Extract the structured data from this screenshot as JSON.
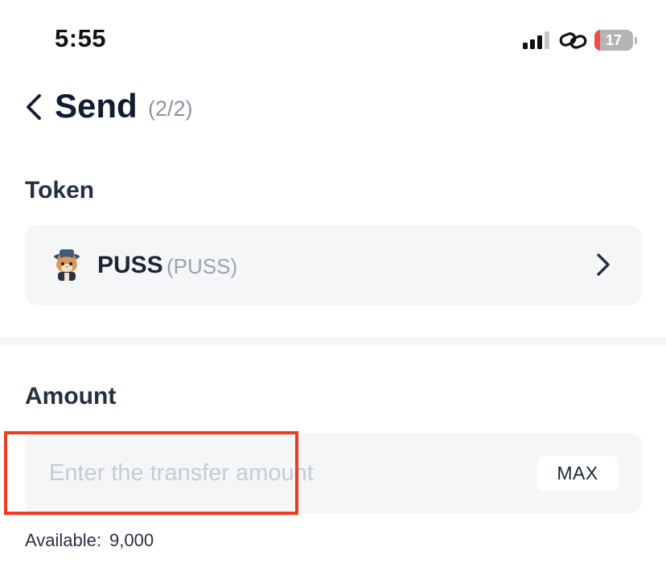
{
  "status_bar": {
    "time": "5:55",
    "battery_level": "17",
    "icons": [
      "signal-icon",
      "link-icon",
      "battery-icon"
    ]
  },
  "header": {
    "title": "Send",
    "step": "(2/2)",
    "back_icon": "chevron-left-icon"
  },
  "token_section": {
    "label": "Token",
    "selected_token": {
      "name": "PUSS",
      "symbol": "(PUSS)",
      "avatar": "cat-token-avatar",
      "chevron_icon": "chevron-right-icon"
    }
  },
  "amount_section": {
    "label": "Amount",
    "input_value": "",
    "placeholder": "Enter the transfer amount",
    "max_label": "MAX",
    "available_label": "Available:",
    "available_value": "9,000"
  },
  "colors": {
    "title": "#0f1c33",
    "field_background": "#f5f6f8",
    "highlight": "#ee3a1f",
    "battery_low": "#ea4f44"
  }
}
